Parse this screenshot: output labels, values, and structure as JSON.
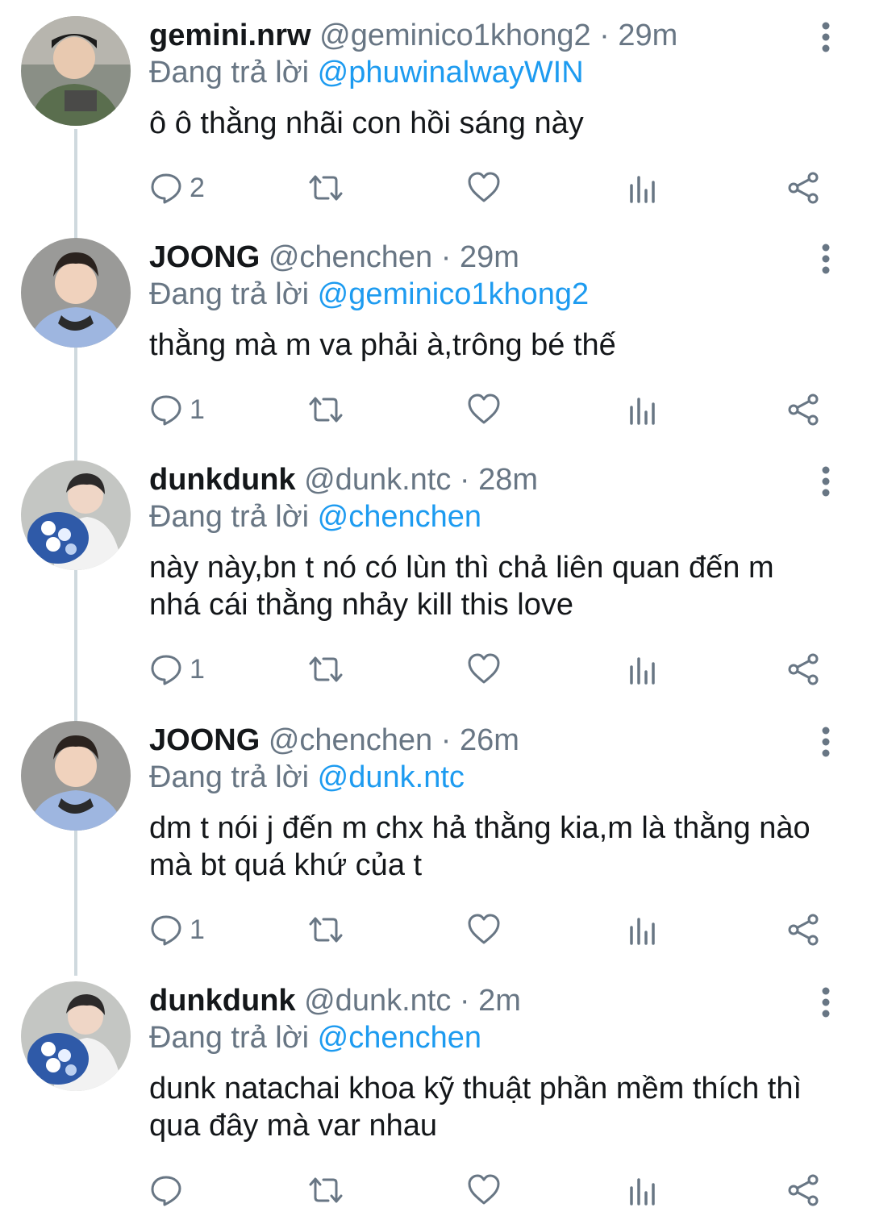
{
  "colors": {
    "link": "#1d9bf0",
    "secondary": "#687684",
    "text": "#14171a",
    "thread_line": "#cfd9de"
  },
  "icons": {
    "reply": "reply-icon",
    "retweet": "retweet-icon",
    "like": "heart-icon",
    "analytics": "analytics-icon",
    "share": "share-icon",
    "more": "more-vertical-icon"
  },
  "tweets": [
    {
      "name": "gemini.nrw",
      "handle": "@geminico1khong2",
      "dot": "·",
      "time": "29m",
      "replying_prefix": "Đang trả lời",
      "replying_to": "@phuwinalwayWIN",
      "text": "ô ô thằng nhãi con hồi sáng này",
      "reply_count": "2"
    },
    {
      "name": "JOONG",
      "handle": "@chenchen",
      "dot": "·",
      "time": "29m",
      "replying_prefix": "Đang trả lời",
      "replying_to": "@geminico1khong2",
      "text": "thằng mà m va phải à,trông bé thế",
      "reply_count": "1"
    },
    {
      "name": "dunkdunk",
      "handle": "@dunk.ntc",
      "dot": "·",
      "time": "28m",
      "replying_prefix": "Đang trả lời",
      "replying_to": "@chenchen",
      "text": "này này,bn t nó có lùn thì chả liên quan đến m nhá cái thằng nhảy kill this love",
      "reply_count": "1"
    },
    {
      "name": "JOONG",
      "handle": "@chenchen",
      "dot": "·",
      "time": "26m",
      "replying_prefix": "Đang trả lời",
      "replying_to": "@dunk.ntc",
      "text": "dm t nói j đến m chx hả thằng kia,m là thằng nào mà bt quá khứ của t",
      "reply_count": "1"
    },
    {
      "name": "dunkdunk",
      "handle": "@dunk.ntc",
      "dot": "·",
      "time": "2m",
      "replying_prefix": "Đang trả lời",
      "replying_to": "@chenchen",
      "text": "dunk natachai khoa kỹ thuật phần mềm thích thì qua đây mà var nhau",
      "reply_count": ""
    }
  ]
}
